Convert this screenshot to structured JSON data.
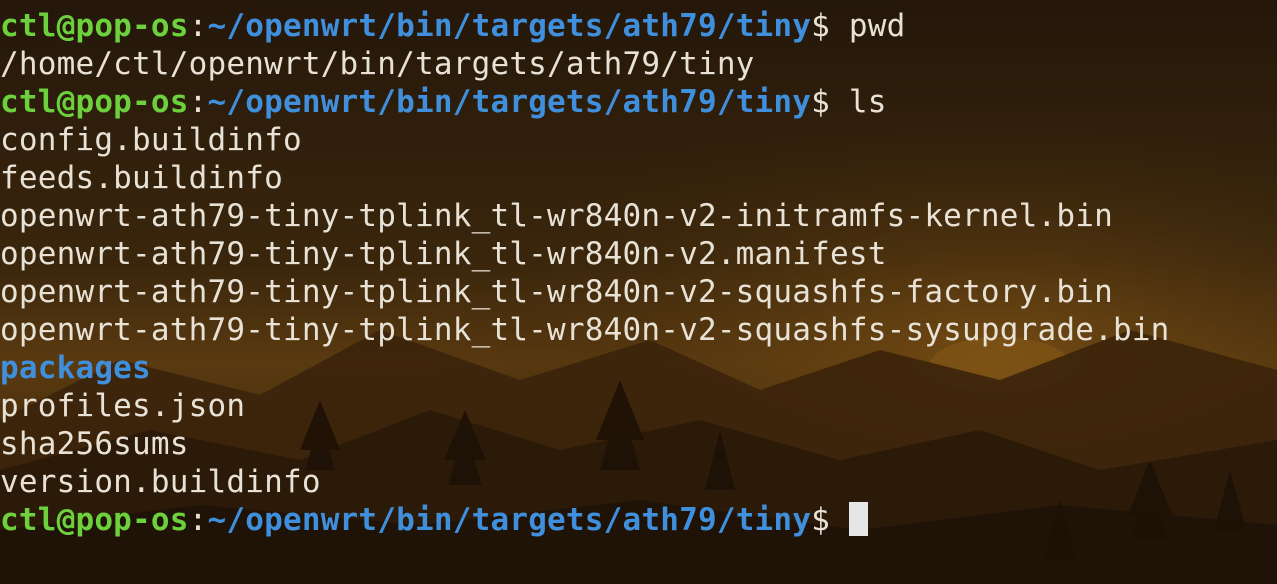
{
  "prompt": {
    "user_host": "ctl@pop-os",
    "separator": ":",
    "path": "~/openwrt/bin/targets/ath79/tiny",
    "symbol": "$"
  },
  "commands": {
    "first": "pwd",
    "second": "ls"
  },
  "pwd_output": "/home/ctl/openwrt/bin/targets/ath79/tiny",
  "ls_output": [
    {
      "name": "config.buildinfo",
      "type": "file"
    },
    {
      "name": "feeds.buildinfo",
      "type": "file"
    },
    {
      "name": "openwrt-ath79-tiny-tplink_tl-wr840n-v2-initramfs-kernel.bin",
      "type": "file"
    },
    {
      "name": "openwrt-ath79-tiny-tplink_tl-wr840n-v2.manifest",
      "type": "file"
    },
    {
      "name": "openwrt-ath79-tiny-tplink_tl-wr840n-v2-squashfs-factory.bin",
      "type": "file"
    },
    {
      "name": "openwrt-ath79-tiny-tplink_tl-wr840n-v2-squashfs-sysupgrade.bin",
      "type": "file"
    },
    {
      "name": "packages",
      "type": "directory"
    },
    {
      "name": "profiles.json",
      "type": "file"
    },
    {
      "name": "sha256sums",
      "type": "file"
    },
    {
      "name": "version.buildinfo",
      "type": "file"
    }
  ],
  "colors": {
    "user_host": "#6cd13c",
    "path": "#3f8fdc",
    "directory": "#3f8fdc",
    "text": "#e8e2d6",
    "background": "#2a1a08"
  }
}
